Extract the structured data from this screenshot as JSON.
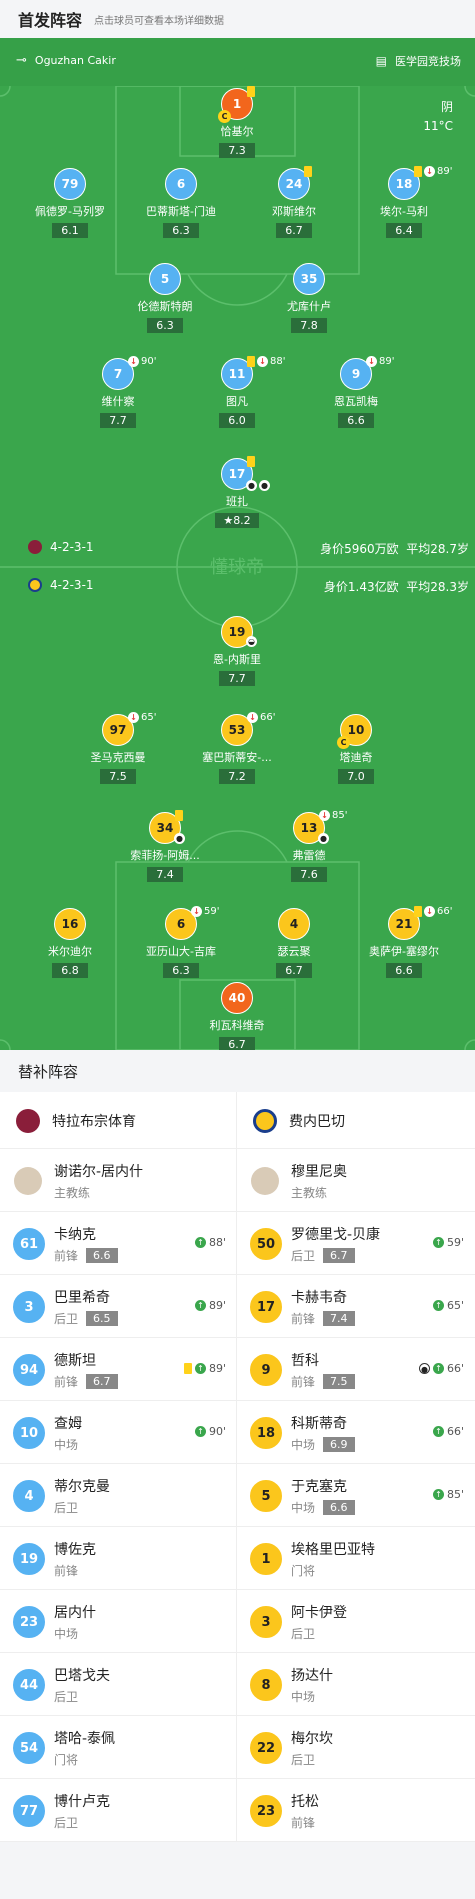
{
  "header": {
    "title": "首发阵容",
    "subtitle": "点击球员可查看本场详细数据"
  },
  "pitch_info": {
    "referee": "Oguzhan Cakir",
    "stadium": "医学园竞技场",
    "weather": "阴",
    "temperature": "11°C"
  },
  "home": {
    "formation": "4-2-3-1",
    "value": "身价5960万欧",
    "avg_age": "平均28.7岁",
    "name": "特拉布宗体育"
  },
  "away": {
    "formation": "4-2-3-1",
    "value": "身价1.43亿欧",
    "avg_age": "平均28.3岁",
    "name": "费内巴切"
  },
  "watermark": "懂球帝",
  "home_players": [
    {
      "no": "1",
      "name": "恰基尔",
      "rating": "7.3"
    },
    {
      "no": "79",
      "name": "佩德罗-马列罗",
      "rating": "6.1"
    },
    {
      "no": "6",
      "name": "巴蒂斯塔-门迪",
      "rating": "6.3"
    },
    {
      "no": "24",
      "name": "邓斯维尔",
      "rating": "6.7"
    },
    {
      "no": "18",
      "name": "埃尔-马利",
      "rating": "6.4",
      "sub": "89'"
    },
    {
      "no": "5",
      "name": "伦德斯特朗",
      "rating": "6.3"
    },
    {
      "no": "35",
      "name": "尤库什卢",
      "rating": "7.8"
    },
    {
      "no": "7",
      "name": "维什察",
      "rating": "7.7",
      "sub": "90'"
    },
    {
      "no": "11",
      "name": "图凡",
      "rating": "6.0",
      "sub": "88'"
    },
    {
      "no": "9",
      "name": "恩瓦凯梅",
      "rating": "6.6",
      "sub": "89'"
    },
    {
      "no": "17",
      "name": "班扎",
      "rating": "8.2"
    }
  ],
  "away_players": [
    {
      "no": "19",
      "name": "恩-内斯里",
      "rating": "7.7"
    },
    {
      "no": "97",
      "name": "圣马克西曼",
      "rating": "7.5",
      "sub": "65'"
    },
    {
      "no": "53",
      "name": "塞巴斯蒂安-...",
      "rating": "7.2",
      "sub": "66'"
    },
    {
      "no": "10",
      "name": "塔迪奇",
      "rating": "7.0"
    },
    {
      "no": "34",
      "name": "索菲扬-阿姆...",
      "rating": "7.4"
    },
    {
      "no": "13",
      "name": "弗雷德",
      "rating": "7.6",
      "sub": "85'"
    },
    {
      "no": "16",
      "name": "米尔迪尔",
      "rating": "6.8"
    },
    {
      "no": "6",
      "name": "亚历山大-吉库",
      "rating": "6.3",
      "sub": "59'"
    },
    {
      "no": "4",
      "name": "瑟云聚",
      "rating": "6.7"
    },
    {
      "no": "21",
      "name": "奥萨伊-塞缪尔",
      "rating": "6.6",
      "sub": "66'"
    },
    {
      "no": "40",
      "name": "利瓦科维奇",
      "rating": "6.7"
    }
  ],
  "subs_header": "替补阵容",
  "coaches": {
    "home": {
      "name": "谢诺尔-居内什",
      "role": "主教练"
    },
    "away": {
      "name": "穆里尼奥",
      "role": "主教练"
    }
  },
  "subs_home": [
    {
      "no": "61",
      "name": "卡纳克",
      "pos": "前锋",
      "rating": "6.6",
      "event": "88'"
    },
    {
      "no": "3",
      "name": "巴里希奇",
      "pos": "后卫",
      "rating": "6.5",
      "event": "89'"
    },
    {
      "no": "94",
      "name": "德斯坦",
      "pos": "前锋",
      "rating": "6.7",
      "event": "89'"
    },
    {
      "no": "10",
      "name": "查姆",
      "pos": "中场",
      "rating": "",
      "event": "90'"
    },
    {
      "no": "4",
      "name": "蒂尔克曼",
      "pos": "后卫",
      "rating": "",
      "event": ""
    },
    {
      "no": "19",
      "name": "博佐克",
      "pos": "前锋",
      "rating": "",
      "event": ""
    },
    {
      "no": "23",
      "name": "居内什",
      "pos": "中场",
      "rating": "",
      "event": ""
    },
    {
      "no": "44",
      "name": "巴塔戈夫",
      "pos": "后卫",
      "rating": "",
      "event": ""
    },
    {
      "no": "54",
      "name": "塔哈-泰佩",
      "pos": "门将",
      "rating": "",
      "event": ""
    },
    {
      "no": "77",
      "name": "博什卢克",
      "pos": "后卫",
      "rating": "",
      "event": ""
    }
  ],
  "subs_away": [
    {
      "no": "50",
      "name": "罗德里戈-贝康",
      "pos": "后卫",
      "rating": "6.7",
      "event": "59'"
    },
    {
      "no": "17",
      "name": "卡赫韦奇",
      "pos": "前锋",
      "rating": "7.4",
      "event": "65'"
    },
    {
      "no": "9",
      "name": "哲科",
      "pos": "前锋",
      "rating": "7.5",
      "event": "66'"
    },
    {
      "no": "18",
      "name": "科斯蒂奇",
      "pos": "中场",
      "rating": "6.9",
      "event": "66'"
    },
    {
      "no": "5",
      "name": "于克塞克",
      "pos": "中场",
      "rating": "6.6",
      "event": "85'"
    },
    {
      "no": "1",
      "name": "埃格里巴亚特",
      "pos": "门将",
      "rating": "",
      "event": ""
    },
    {
      "no": "3",
      "name": "阿卡伊登",
      "pos": "后卫",
      "rating": "",
      "event": ""
    },
    {
      "no": "8",
      "name": "扬达什",
      "pos": "中场",
      "rating": "",
      "event": ""
    },
    {
      "no": "22",
      "name": "梅尔坎",
      "pos": "后卫",
      "rating": "",
      "event": ""
    },
    {
      "no": "23",
      "name": "托松",
      "pos": "前锋",
      "rating": "",
      "event": ""
    }
  ]
}
